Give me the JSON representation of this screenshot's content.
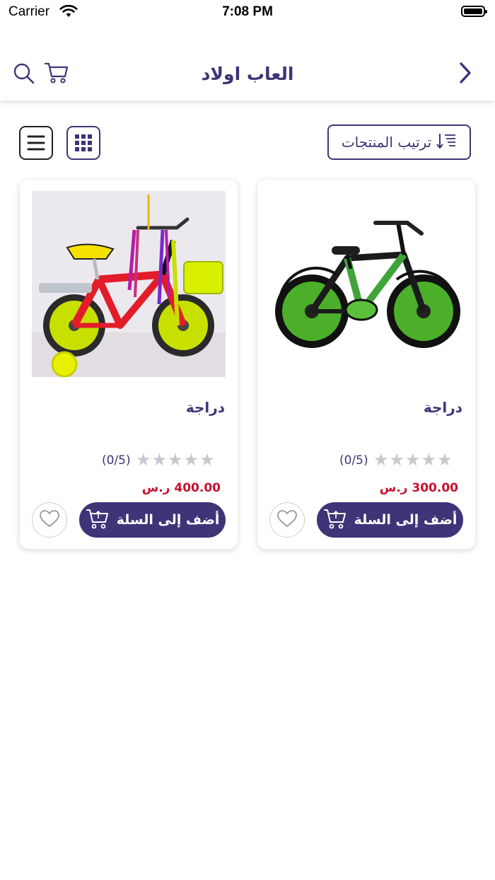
{
  "status_bar": {
    "carrier": "Carrier",
    "time": "7:08 PM"
  },
  "header": {
    "title": "العاب اولاد"
  },
  "toolbar": {
    "sort_label": "ترتيب المنتجات"
  },
  "products": [
    {
      "name": "دراجة",
      "rating_text": "(0/5)",
      "price": "300.00 ر.س",
      "add_to_cart": "أضف إلى السلة",
      "stars_filled": 0,
      "stars_total": 5
    },
    {
      "name": "دراجة",
      "rating_text": "(0/5)",
      "price": "400.00 ر.س",
      "add_to_cart": "أضف إلى السلة",
      "stars_filled": 0,
      "stars_total": 5
    }
  ],
  "colors": {
    "primary": "#3d3577",
    "price": "#c8102e",
    "star_empty": "#c6c8cc"
  },
  "icons": [
    "wifi-icon",
    "battery-icon",
    "search-icon",
    "cart-icon",
    "chevron-right-icon",
    "sort-icon",
    "grid-view-icon",
    "list-view-icon",
    "heart-icon",
    "cart-add-icon",
    "star-icon"
  ]
}
